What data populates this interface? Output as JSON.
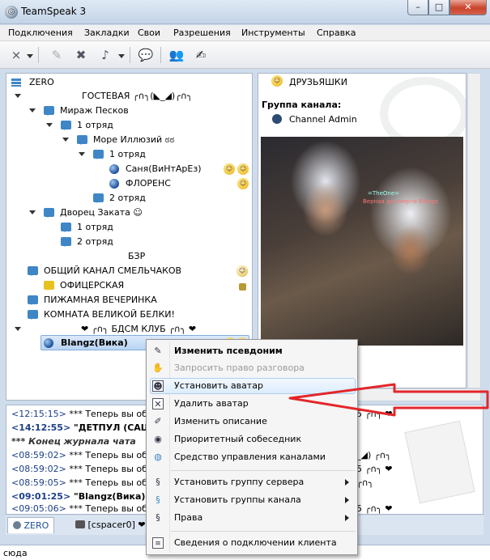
{
  "window": {
    "title": "TeamSpeak 3",
    "min": "–",
    "max": "□",
    "close": "✕"
  },
  "menu": [
    "Подключения",
    "Закладки",
    "Свои",
    "Разрешения",
    "Инструменты",
    "Справка"
  ],
  "tree": {
    "server": "ZERO",
    "rows": [
      {
        "text": "ГОСТЕВАЯ ╭∩╮(◣_◢)╭∩╮",
        "kind": "spacer"
      },
      {
        "text": "Мираж Песков",
        "kind": "channel"
      },
      {
        "text": "1 отряд",
        "kind": "channel"
      },
      {
        "text": "Море Иллюзий ಠಠ",
        "kind": "channel"
      },
      {
        "text": "1 отряд",
        "kind": "channel"
      },
      {
        "text": "Саня(ВиНтАрЕз)",
        "kind": "client"
      },
      {
        "text": "ФЛОРЕНС",
        "kind": "client"
      },
      {
        "text": "2 отряд",
        "kind": "channel"
      },
      {
        "text": "Дворец Заката ☺",
        "kind": "channel"
      },
      {
        "text": "1 отряд",
        "kind": "channel"
      },
      {
        "text": "2 отряд",
        "kind": "channel"
      },
      {
        "text": "БЗР",
        "kind": "spacer"
      },
      {
        "text": "ОБЩИЙ КАНАЛ СМЕЛЬЧАКОВ",
        "kind": "channel"
      },
      {
        "text": "ОФИЦЕРСКАЯ",
        "kind": "channel"
      },
      {
        "text": "ПИЖАМНАЯ ВЕЧЕРИНКА",
        "kind": "channel"
      },
      {
        "text": "КОМНАТА ВЕЛИКОЙ БЕЛКИ!",
        "kind": "channel"
      },
      {
        "text": "❤ ╭∩╮ БДСМ КЛУБ ╭∩╮ ❤",
        "kind": "spacer"
      },
      {
        "text": "Blangz(Вика)",
        "kind": "client-selected"
      }
    ]
  },
  "info": {
    "channel_name": "ДРУЗЬЯШКИ",
    "group_label": "Группа канала:",
    "group_value": "Channel Admin",
    "avatar_overlay_1": "=TheOne=",
    "avatar_overlay_2": "Верная до смерти Blangz"
  },
  "chat": [
    {
      "time": "<12:15:15>",
      "text": "*** Теперь вы общ",
      "tail": "5 ╭∩╮ ❤"
    },
    {
      "time": "<14:12:55>",
      "text": "\"ДЕТПУЛ (САША",
      "tail": ""
    },
    {
      "time": "",
      "text": "*** Конец журнала чата",
      "tail": ""
    },
    {
      "time": "<08:59:02>",
      "text": "*** Теперь вы обц",
      "tail": "_◢) ╭∩╮"
    },
    {
      "time": "<08:59:02>",
      "text": "*** Теперь вы обц",
      "tail": "5 ╭∩╮ ❤"
    },
    {
      "time": "<08:59:05>",
      "text": "*** Теперь вы обц",
      "tail": "╭∩╮"
    },
    {
      "time": "<09:01:25>",
      "text": "\"Blangz(Вика)\":",
      "tail": ""
    },
    {
      "time": "<09:05:06>",
      "text": "*** Теперь вы обц",
      "tail": "5 ╭∩╮ ❤"
    }
  ],
  "tabs": {
    "server": "ZERO",
    "channel": "[cspacer0] ❤"
  },
  "input": {
    "text": "сюда"
  },
  "context_menu": [
    {
      "label": "Изменить псевдоним",
      "icon": "pencil-icon",
      "bold": true
    },
    {
      "label": "Запросить право разговора",
      "icon": "request-talk-icon",
      "disabled": true
    },
    {
      "label": "Установить аватар",
      "icon": "avatar-icon",
      "highlight": true
    },
    {
      "label": "Удалить аватар",
      "icon": "delete-avatar-icon"
    },
    {
      "label": "Изменить описание",
      "icon": "description-icon"
    },
    {
      "label": "Приоритетный собеседник",
      "icon": "priority-speaker-icon"
    },
    {
      "label": "Средство управления каналами",
      "icon": "channel-commander-icon"
    },
    {
      "label": "Установить группу сервера",
      "icon": "server-group-icon",
      "submenu": true
    },
    {
      "label": "Установить группы канала",
      "icon": "channel-group-icon",
      "submenu": true
    },
    {
      "label": "Права",
      "icon": "permissions-icon",
      "submenu": true
    },
    {
      "label": "Сведения о подключении клиента",
      "icon": "connection-info-icon"
    }
  ],
  "colors": {
    "accent": "#3f86c6",
    "arrow": "#e3262a"
  }
}
